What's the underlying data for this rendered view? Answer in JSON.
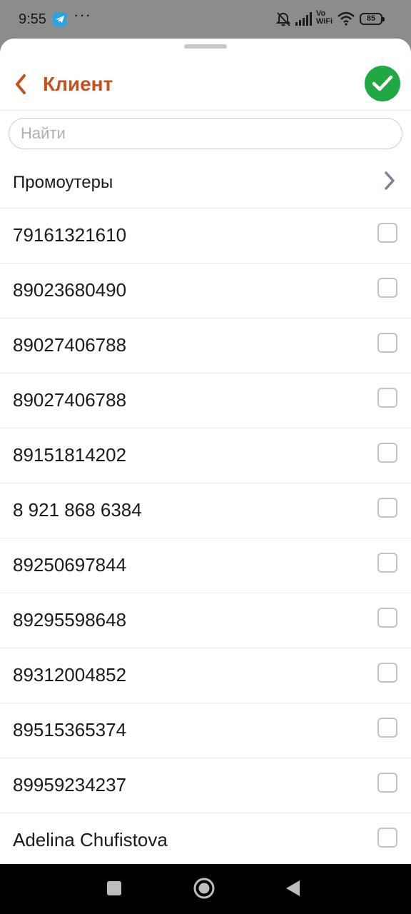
{
  "status_bar": {
    "time": "9:55",
    "more": "···",
    "vowifi_line1": "Vo",
    "vowifi_line2": "WiFi",
    "battery": "85",
    "icons": [
      "telegram-icon",
      "bell-off-icon",
      "signal-icon",
      "wifi-icon",
      "battery-icon"
    ]
  },
  "header": {
    "title": "Клиент",
    "back_icon": "chevron-left-icon",
    "confirm_icon": "check-icon",
    "accent_color": "#c8501e",
    "confirm_color": "#1fa843"
  },
  "search": {
    "placeholder": "Найти",
    "value": ""
  },
  "group": {
    "label": "Промоутеры"
  },
  "clients": [
    {
      "label": "79161321610",
      "checked": false
    },
    {
      "label": "89023680490",
      "checked": false
    },
    {
      "label": "89027406788",
      "checked": false
    },
    {
      "label": "89027406788",
      "checked": false
    },
    {
      "label": "89151814202",
      "checked": false
    },
    {
      "label": "8 921 868 6384",
      "checked": false
    },
    {
      "label": "89250697844",
      "checked": false
    },
    {
      "label": "89295598648",
      "checked": false
    },
    {
      "label": "89312004852",
      "checked": false
    },
    {
      "label": "89515365374",
      "checked": false
    },
    {
      "label": "89959234237",
      "checked": false
    },
    {
      "label": "Adelina Chufistova",
      "checked": false
    }
  ],
  "nav_bar": {
    "icons": [
      "recents-icon",
      "home-icon",
      "back-icon"
    ]
  }
}
